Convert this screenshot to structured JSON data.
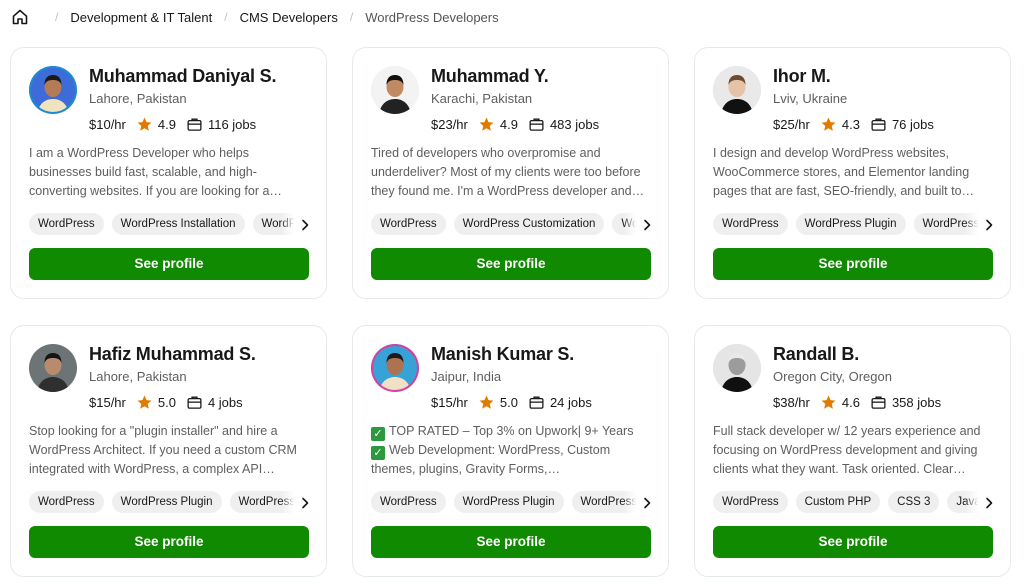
{
  "breadcrumb": {
    "items": [
      "Development & IT Talent",
      "CMS Developers",
      "WordPress Developers"
    ]
  },
  "colors": {
    "accent_green": "#108a00",
    "star": "#e07b00",
    "skill_bg": "#efefef"
  },
  "cards": [
    {
      "name": "Muhammad Daniyal S.",
      "location": "Lahore, Pakistan",
      "rate": "$10/hr",
      "rating": "4.9",
      "jobs": "116 jobs",
      "description": "I am a WordPress Developer who helps businesses build fast, scalable, and high-converting websites. If you are looking for a…",
      "skills": [
        "WordPress",
        "WordPress Installation",
        "WordPress"
      ],
      "button": "See profile"
    },
    {
      "name": "Muhammad Y.",
      "location": "Karachi, Pakistan",
      "rate": "$23/hr",
      "rating": "4.9",
      "jobs": "483 jobs",
      "description": "Tired of developers who overpromise and underdeliver? Most of my clients were too before they found me. I'm a WordPress developer and…",
      "skills": [
        "WordPress",
        "WordPress Customization",
        "WordPress"
      ],
      "button": "See profile"
    },
    {
      "name": "Ihor M.",
      "location": "Lviv, Ukraine",
      "rate": "$25/hr",
      "rating": "4.3",
      "jobs": "76 jobs",
      "description": "I design and develop WordPress websites, WooCommerce stores, and Elementor landing pages that are fast, SEO-friendly, and built to…",
      "skills": [
        "WordPress",
        "WordPress Plugin",
        "WordPress"
      ],
      "button": "See profile"
    },
    {
      "name": "Hafiz Muhammad S.",
      "location": "Lahore, Pakistan",
      "rate": "$15/hr",
      "rating": "5.0",
      "jobs": "4 jobs",
      "description": "Stop looking for a \"plugin installer\" and hire a WordPress Architect. If you need a custom CRM integrated with WordPress, a complex API…",
      "skills": [
        "WordPress",
        "WordPress Plugin",
        "WordPress"
      ],
      "button": "See profile"
    },
    {
      "name": "Manish Kumar S.",
      "location": "Jaipur, India",
      "rate": "$15/hr",
      "rating": "5.0",
      "jobs": "24 jobs",
      "description_lines": [
        "TOP RATED – Top 3% on Upwork| 9+ Years",
        "Web Development: WordPress, Custom themes, plugins, Gravity Forms, WooCommerce,…"
      ],
      "skills": [
        "WordPress",
        "WordPress Plugin",
        "WordPress"
      ],
      "button": "See profile"
    },
    {
      "name": "Randall B.",
      "location": "Oregon City, Oregon",
      "rate": "$38/hr",
      "rating": "4.6",
      "jobs": "358 jobs",
      "description": "Full stack developer w/ 12 years experience and focusing on WordPress development and giving clients what they want. Task oriented. Clear…",
      "skills": [
        "WordPress",
        "Custom PHP",
        "CSS 3",
        "JavaScript"
      ],
      "button": "See profile"
    }
  ]
}
